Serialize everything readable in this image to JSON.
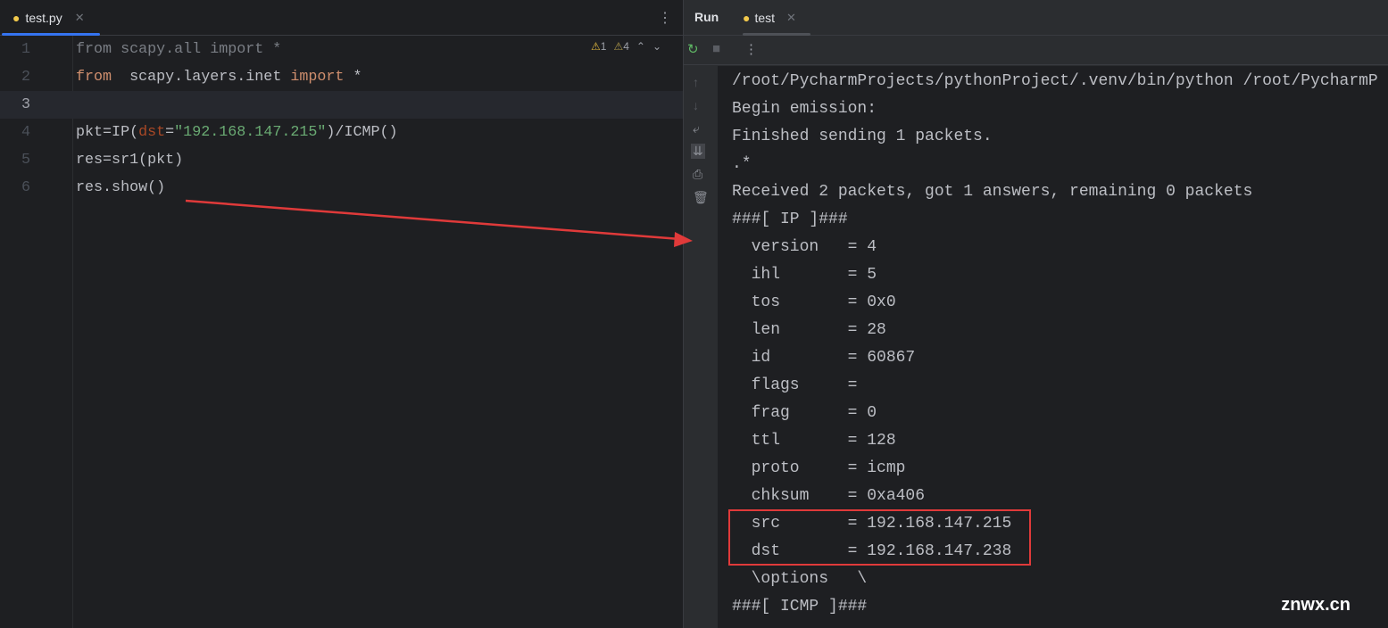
{
  "editor": {
    "tab": "test.py",
    "gutter": [
      "1",
      "2",
      "3",
      "4",
      "5",
      "6"
    ],
    "warnings": {
      "errors": "1",
      "warnings": "4"
    }
  },
  "code": {
    "l1": "from scapy.all import *",
    "l2": {
      "kw1": "from",
      "rest": "  scapy.layers.inet ",
      "kw2": "import",
      "end": " *"
    },
    "l4": {
      "a": "pkt=IP(",
      "p": "dst",
      "b": "=",
      "s": "\"192.168.147.215\"",
      "c": ")/ICMP()"
    },
    "l5": "res=sr1(pkt)",
    "l6": "res.show()"
  },
  "run": {
    "label": "Run",
    "tab": "test"
  },
  "console": [
    "/root/PycharmProjects/pythonProject/.venv/bin/python /root/PycharmP",
    "Begin emission:",
    "Finished sending 1 packets.",
    ".*",
    "Received 2 packets, got 1 answers, remaining 0 packets",
    "###[ IP ]###",
    "  version   = 4",
    "  ihl       = 5",
    "  tos       = 0x0",
    "  len       = 28",
    "  id        = 60867",
    "  flags     = ",
    "  frag      = 0",
    "  ttl       = 128",
    "  proto     = icmp",
    "  chksum    = 0xa406",
    "  src       = 192.168.147.215",
    "  dst       = 192.168.147.238",
    "  \\options   \\",
    "###[ ICMP ]###"
  ],
  "watermark": "znwx.cn",
  "colors": {
    "annotation": "#e03a3a",
    "accent": "#3574f0"
  }
}
